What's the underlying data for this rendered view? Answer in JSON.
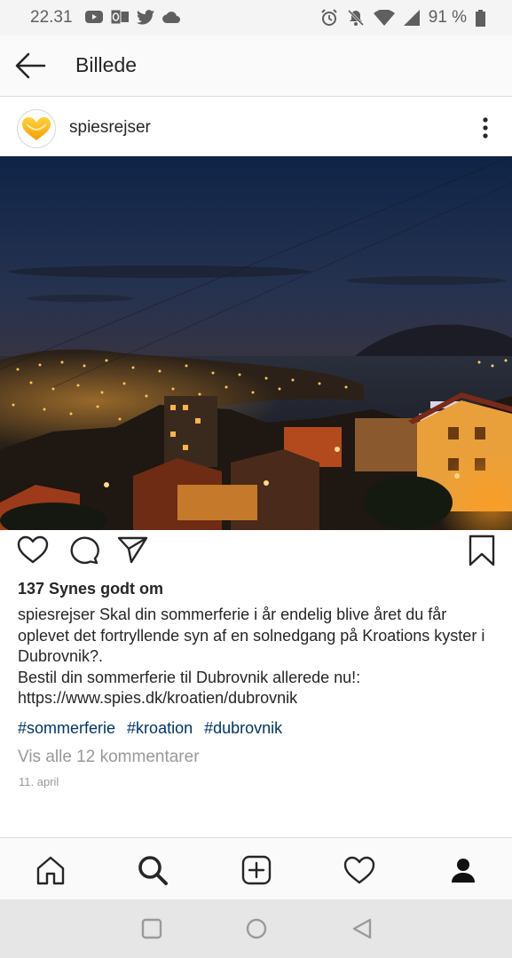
{
  "status_bar": {
    "time": "22.31",
    "battery_percent": "91 %",
    "left_icons": [
      "youtube-icon",
      "outlook-icon",
      "twitter-icon",
      "cloud-icon"
    ],
    "right_icons": [
      "alarm-icon",
      "mute-icon",
      "wifi-icon",
      "signal-icon",
      "battery-icon"
    ]
  },
  "app_bar": {
    "title": "Billede"
  },
  "post": {
    "username": "spiesrejser",
    "likes": "137 Synes godt om",
    "caption_user": "spiesrejser",
    "caption_text": "Skal din sommerferie i år endelig blive året du får oplevet det fortryllende syn af en solnedgang på Kroations kyster i Dubrovnik?.",
    "caption_line2": "Bestil din sommerferie til Dubrovnik allerede nu!: https://www.spies.dk/kroatien/dubrovnik",
    "hashtags": [
      "#sommerferie",
      "#kroation",
      "#dubrovnik"
    ],
    "comments_link": "Vis alle 12 kommentarer",
    "date": "11. april"
  },
  "bottom_nav": [
    "home-icon",
    "search-icon",
    "add-post-icon",
    "activity-heart-icon",
    "profile-icon"
  ],
  "colors": {
    "hashtag": "#003569",
    "muted": "#999999",
    "text": "#262626"
  }
}
